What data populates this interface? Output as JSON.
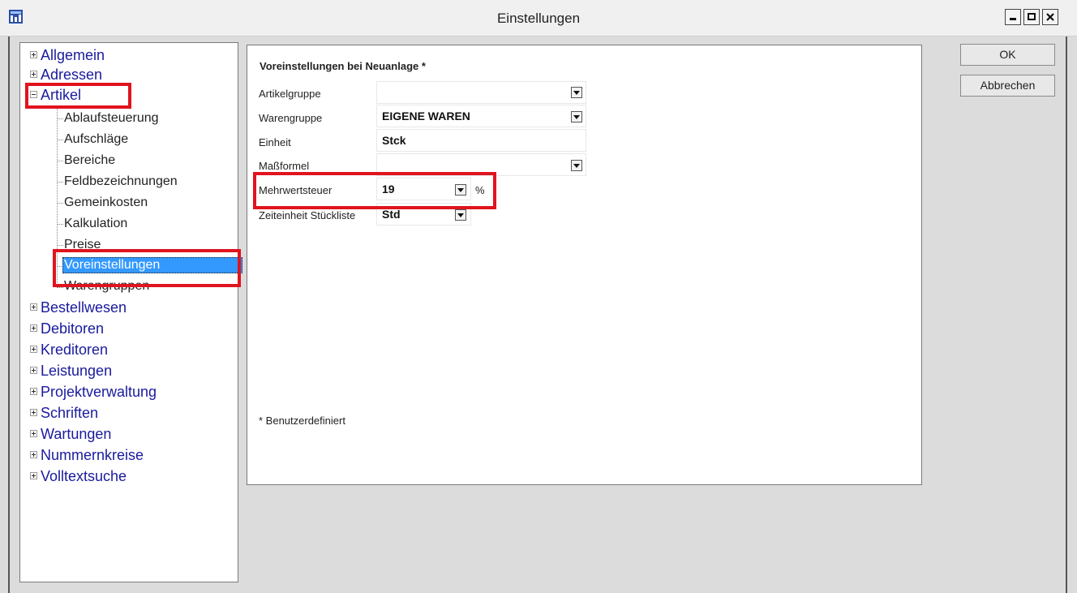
{
  "window": {
    "title": "Einstellungen",
    "buttons": {
      "ok": "OK",
      "cancel": "Abbrechen"
    }
  },
  "tree": {
    "top": [
      "Allgemein",
      "Adressen",
      "Artikel"
    ],
    "artikel_children": [
      "Ablaufsteuerung",
      "Aufschläge",
      "Bereiche",
      "Feldbezeichnungen",
      "Gemeinkosten",
      "Kalkulation",
      "Preise",
      "Voreinstellungen",
      "Warengruppen"
    ],
    "bottom": [
      "Bestellwesen",
      "Debitoren",
      "Kreditoren",
      "Leistungen",
      "Projektverwaltung",
      "Schriften",
      "Wartungen",
      "Nummernkreise",
      "Volltextsuche"
    ],
    "selected": "Voreinstellungen"
  },
  "form": {
    "section_title": "Voreinstellungen bei Neuanlage *",
    "fields": [
      {
        "label": "Artikelgruppe",
        "value": ""
      },
      {
        "label": "Warengruppe",
        "value": "EIGENE WAREN"
      },
      {
        "label": "Einheit",
        "value": "Stck"
      },
      {
        "label": "Maßformel",
        "value": ""
      },
      {
        "label": "Mehrwertsteuer",
        "value": "19",
        "unit": "%"
      },
      {
        "label": "Zeiteinheit Stückliste",
        "value": "Std"
      }
    ],
    "footnote": "* Benutzerdefiniert"
  },
  "colors": {
    "highlight": "#e0141e",
    "selection": "#3399ff",
    "tree_link": "#1a1a9e"
  }
}
